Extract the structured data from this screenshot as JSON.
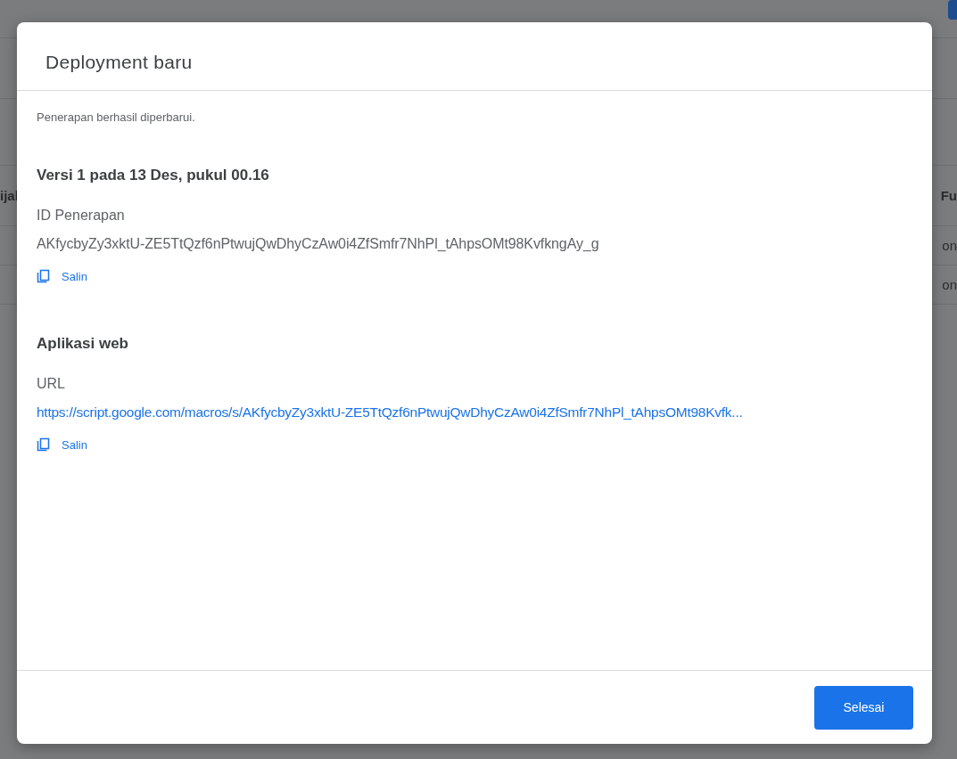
{
  "background_page": {
    "column_header_left": "ijal",
    "column_header_right": "Fu",
    "rows": [
      {
        "cell_right": "on"
      },
      {
        "cell_right": "on"
      }
    ]
  },
  "dialog": {
    "title": "Deployment baru",
    "message": "Penerapan berhasil diperbarui.",
    "sections": [
      {
        "heading": "Versi 1 pada 13 Des, pukul 00.16",
        "label": "ID Penerapan",
        "value": "AKfycbyZy3xktU-ZE5TtQzf6nPtwujQwDhyCzAw0i4ZfSmfr7NhPl_tAhpsOMt98KvfkngAy_g",
        "kind": "text",
        "copy_label": "Salin"
      },
      {
        "heading": "Aplikasi web",
        "label": "URL",
        "value": "https://script.google.com/macros/s/AKfycbyZy3xktU-ZE5TtQzf6nPtwujQwDhyCzAw0i4ZfSmfr7NhPl_tAhpsOMt98Kvfk...",
        "kind": "link",
        "copy_label": "Salin"
      }
    ],
    "done_button": "Selesai"
  }
}
